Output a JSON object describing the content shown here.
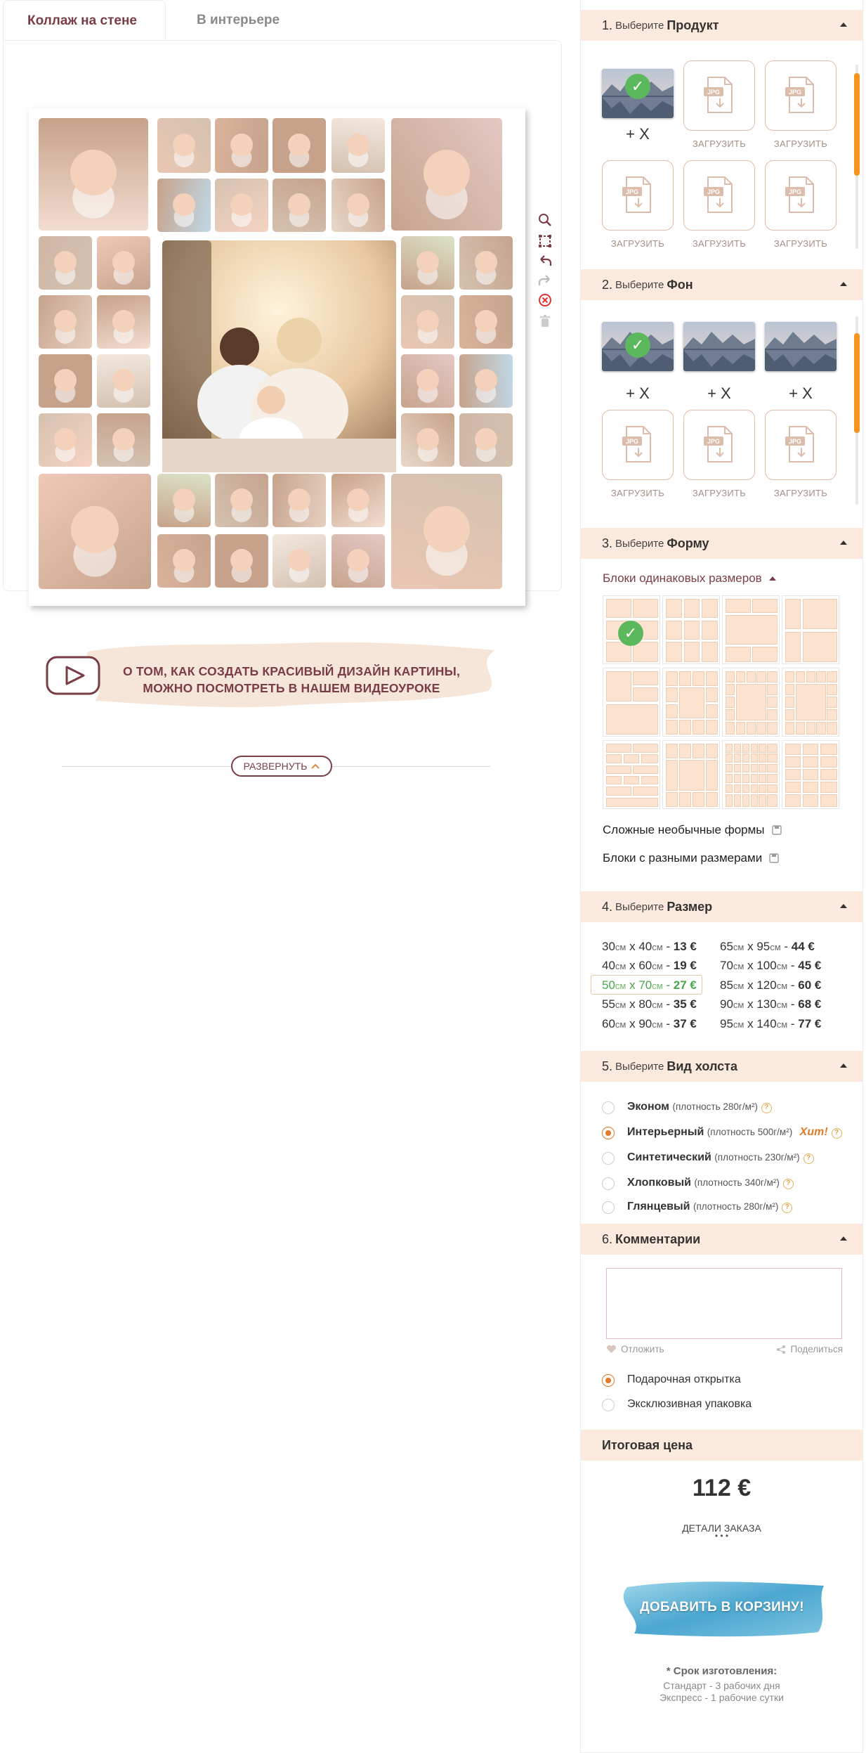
{
  "tabs": [
    {
      "label": "Коллаж на стене"
    },
    {
      "label": "В интерьере"
    }
  ],
  "promo": {
    "line1": "О ТОМ, КАК СОЗДАТЬ КРАСИВЫЙ ДИЗАЙН КАРТИНЫ,",
    "line2": "МОЖНО ПОСМОТРЕТЬ В НАШЕМ ВИДЕОУРОКЕ"
  },
  "expand_label": "РАЗВЕРНУТЬ",
  "sections": {
    "s1": {
      "num": "1.",
      "pre": "Выберите",
      "title": "Продукт"
    },
    "s2": {
      "num": "2.",
      "pre": "Выберите",
      "title": "Фон"
    },
    "s3": {
      "num": "3.",
      "pre": "Выберите",
      "title": "Форму"
    },
    "s4": {
      "num": "4.",
      "pre": "Выберите",
      "title": "Размер"
    },
    "s5": {
      "num": "5.",
      "pre": "Выберите",
      "title": "Вид холста"
    },
    "s6": {
      "num": "6.",
      "pre": "",
      "title": "Комментарии"
    },
    "total": {
      "title": "Итоговая цена"
    }
  },
  "product": {
    "plus_x": "+ X",
    "upload": "ЗАГРУЗИТЬ",
    "jpg": "JPG"
  },
  "background": {
    "plus_x": "+ X",
    "upload": "ЗАГРУЗИТЬ"
  },
  "shape": {
    "same_size_blocks": "Блоки одинаковых размеров",
    "complex_shapes": "Сложные необычные формы",
    "different_size_blocks": "Блоки с разными размерами"
  },
  "sizes": {
    "unit": "см",
    "left": [
      {
        "w": "30",
        "h": "40",
        "price": "13 €"
      },
      {
        "w": "40",
        "h": "60",
        "price": "19 €"
      },
      {
        "w": "50",
        "h": "70",
        "price": "27 €"
      },
      {
        "w": "55",
        "h": "80",
        "price": "35 €"
      },
      {
        "w": "60",
        "h": "90",
        "price": "37 €"
      }
    ],
    "right": [
      {
        "w": "65",
        "h": "95",
        "price": "44 €"
      },
      {
        "w": "70",
        "h": "100",
        "price": "45 €"
      },
      {
        "w": "85",
        "h": "120",
        "price": "60 €"
      },
      {
        "w": "90",
        "h": "130",
        "price": "68 €"
      },
      {
        "w": "95",
        "h": "140",
        "price": "77 €"
      }
    ],
    "selected": "50 x 70"
  },
  "canvas_types": [
    {
      "name": "Эконом",
      "detail": "плотность 280г/м²",
      "selected": false
    },
    {
      "name": "Интерьерный",
      "detail": "плотность 500г/м²",
      "badge": "Хит!",
      "selected": true
    },
    {
      "name": "Синтетический",
      "detail": "плотность 230г/м²",
      "selected": false
    },
    {
      "name": "Хлопковый",
      "detail": "плотность 340г/м²",
      "selected": false
    },
    {
      "name": "Глянцевый",
      "detail": "плотность 280г/м²",
      "selected": false
    }
  ],
  "comments": {
    "postpone": "Отложить",
    "share": "Поделиться",
    "gift_card": "Подарочная открытка",
    "exclusive_pack": "Эксклюзивная упаковка"
  },
  "total": {
    "price": "112 €",
    "details": "ДЕТАЛИ ЗАКАЗА",
    "add_to_cart": "ДОБАВИТЬ В КОРЗИНУ!",
    "term_title": "* Срок изготовления:",
    "term_standard": "Стандарт - 3 рабочих дня",
    "term_express": "Экспресс - 1 рабочие сутки"
  },
  "colors": {
    "accent": "#7a3d45",
    "section_bg": "#fbeadd",
    "orange": "#f7941d",
    "green": "#5cb85c"
  }
}
